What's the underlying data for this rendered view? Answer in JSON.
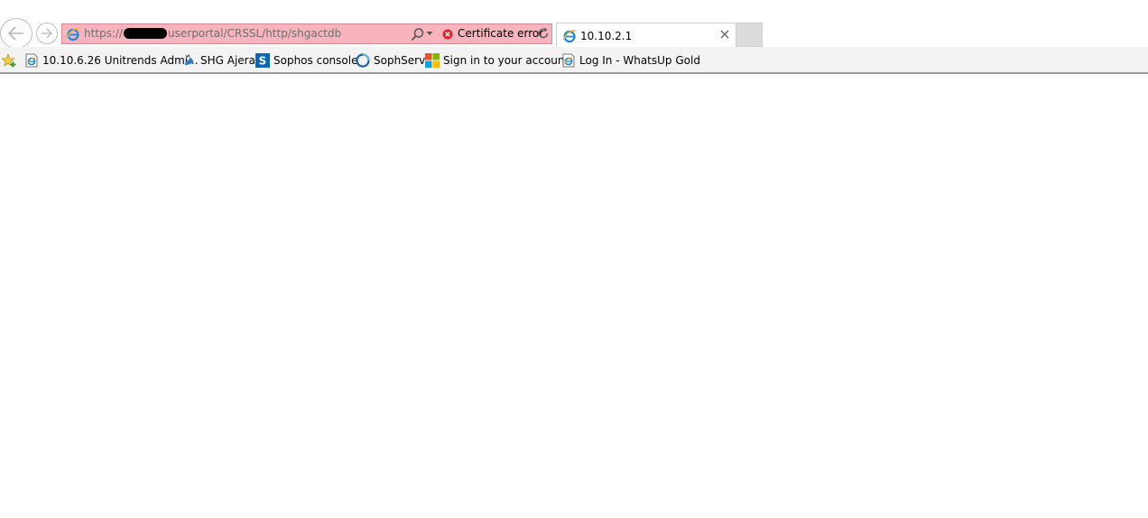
{
  "address_bar": {
    "url_prefix": "https://",
    "url_suffix": "userportal/CRSSL/http/shgactdb",
    "cert_error": "Certificate error"
  },
  "tab": {
    "title": "10.10.2.1"
  },
  "favorites": [
    {
      "label": "10.10.6.26 Unitrends Admi...",
      "icon": "ie-page-icon"
    },
    {
      "label": "SHG Ajera",
      "icon": "ajera-icon"
    },
    {
      "label": "Sophos console",
      "icon": "sophos-icon"
    },
    {
      "label": "SophServ",
      "icon": "sophserv-icon"
    },
    {
      "label": "Sign in to your account",
      "icon": "microsoft-icon"
    },
    {
      "label": "Log In - WhatsUp Gold",
      "icon": "ie-page-icon"
    }
  ],
  "colors": {
    "address_error_bg": "#f8b4bd",
    "cert_error_red": "#d9262f",
    "ie_blue": "#1e88d8",
    "sophos_blue": "#0a66b7"
  }
}
